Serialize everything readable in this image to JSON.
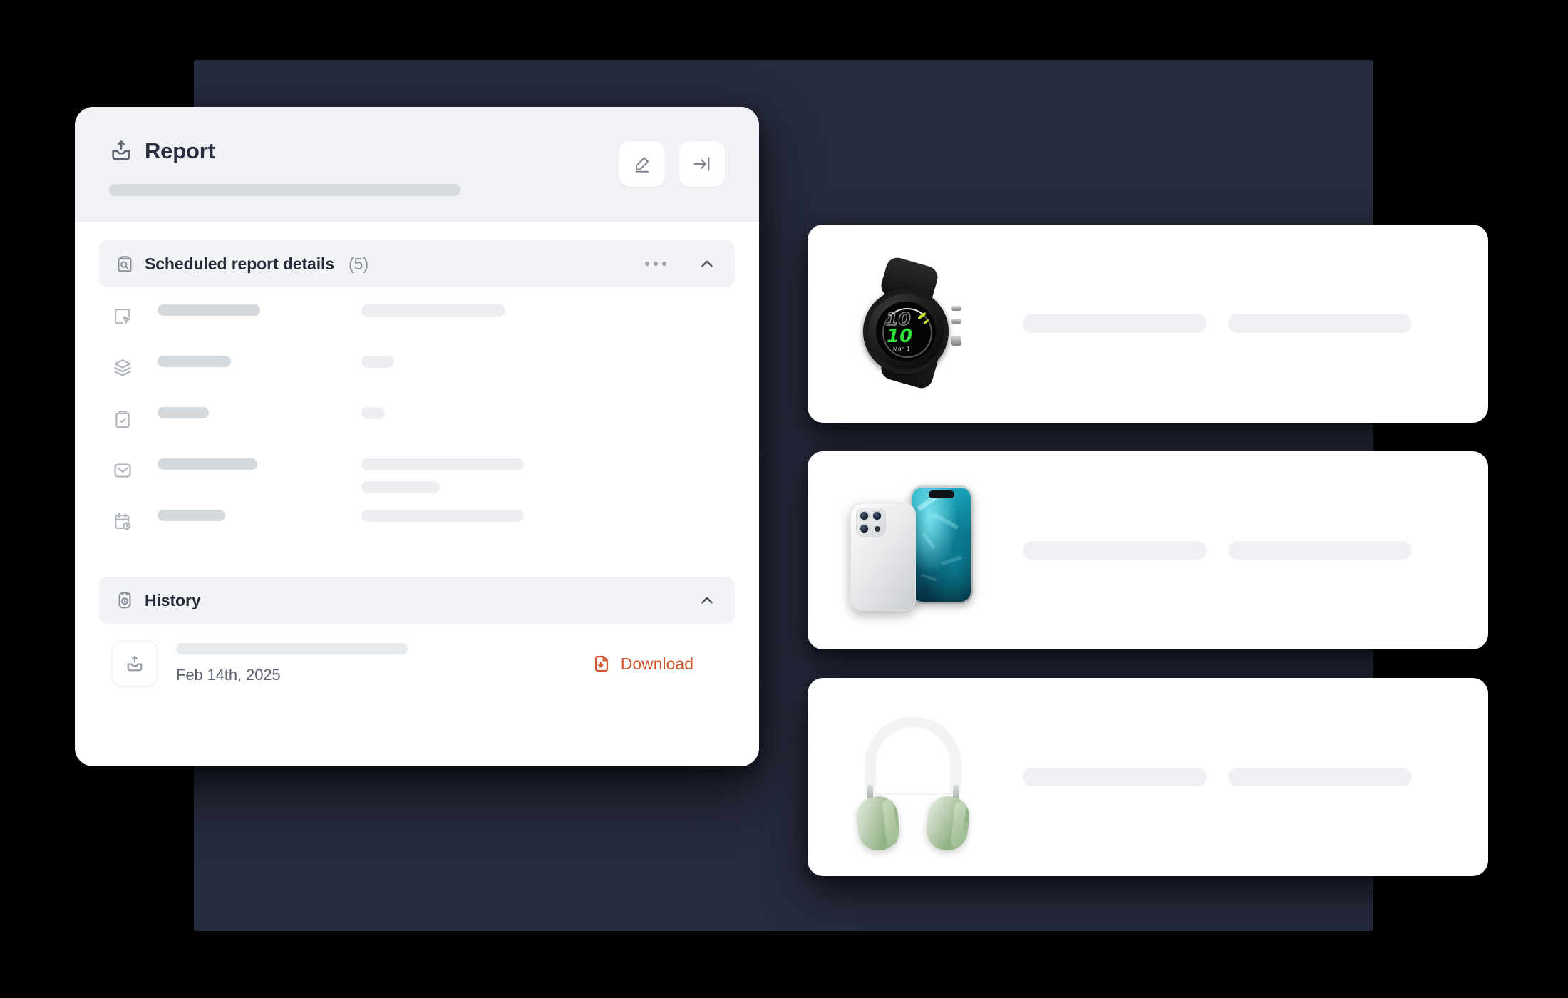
{
  "theme": {
    "backdrop_color": "#262B3D",
    "panel_bg": "#FFFFFF",
    "header_bg": "#F0F2F5",
    "section_bg": "#F1F3F6",
    "accent_color": "#D4532C",
    "skeleton_dark": "#D4D9DE",
    "skeleton_light": "#ECEEF2",
    "title_color": "#29303F"
  },
  "report_panel": {
    "header": {
      "icon": "export-inbox-icon",
      "title": "Report",
      "title_skeleton": true,
      "actions": [
        {
          "name": "edit-button",
          "icon": "pencil-icon"
        },
        {
          "name": "collapse-panel-button",
          "icon": "arrow-right-to-line-icon"
        }
      ]
    },
    "sections": [
      {
        "id": "scheduled-report-details",
        "icon": "clipboard-search-icon",
        "title": "Scheduled report details",
        "count": "(5)",
        "has_overflow_menu": true,
        "overflow_icon": "ellipsis-icon",
        "collapse_icon": "chevron-up-icon",
        "expanded": true,
        "rows": [
          {
            "icon": "cursor-select-icon",
            "label_width": 144,
            "values": [
              202
            ]
          },
          {
            "icon": "layers-icon",
            "label_width": 103,
            "values": [
              46
            ]
          },
          {
            "icon": "clipboard-check-icon",
            "label_width": 72,
            "values": [
              33
            ]
          },
          {
            "icon": "mail-icon",
            "label_width": 140,
            "values": [
              228,
              110
            ]
          },
          {
            "icon": "calendar-clock-icon",
            "label_width": 95,
            "values": [
              228
            ]
          }
        ]
      },
      {
        "id": "history",
        "icon": "stopwatch-icon",
        "title": "History",
        "count": "",
        "has_overflow_menu": false,
        "collapse_icon": "chevron-up-icon",
        "expanded": true,
        "entry": {
          "tile_icon": "export-inbox-icon",
          "title_skeleton": true,
          "date": "Feb 14th, 2025",
          "action": {
            "label": "Download",
            "icon": "file-download-icon",
            "color": "#D4532C"
          }
        }
      }
    ]
  },
  "product_cards": [
    {
      "id": "product-card-watch",
      "image": "black-sports-smartwatch",
      "watch_display": {
        "ghost_number": "10",
        "green_number": "10",
        "day_label": "Mon 1"
      },
      "bars": [
        258,
        258
      ]
    },
    {
      "id": "product-card-phone",
      "image": "silver-smartphone-pair",
      "bars": [
        258,
        258
      ]
    },
    {
      "id": "product-card-headphones",
      "image": "green-over-ear-headphones",
      "bars": [
        258,
        258
      ]
    }
  ]
}
